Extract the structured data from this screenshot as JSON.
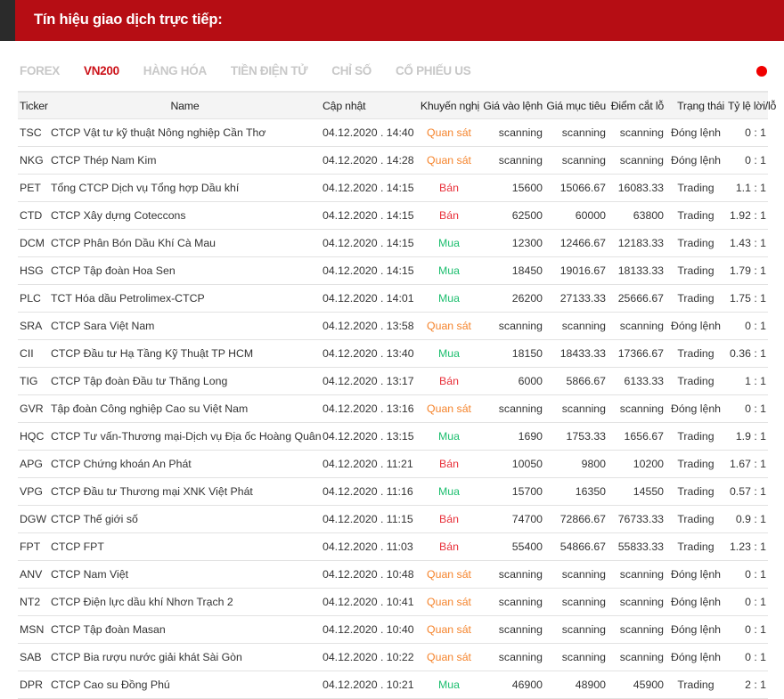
{
  "header": {
    "title": "Tín hiệu giao dịch trực tiếp:"
  },
  "tabs": [
    {
      "label": "FOREX",
      "active": false
    },
    {
      "label": "VN200",
      "active": true
    },
    {
      "label": "HÀNG HÓA",
      "active": false
    },
    {
      "label": "TIỀN ĐIỆN TỬ",
      "active": false
    },
    {
      "label": "CHỈ SỐ",
      "active": false
    },
    {
      "label": "CỔ PHIẾU US",
      "active": false
    }
  ],
  "live_indicator_color": "#f00000",
  "colors": {
    "Quan sát": "#f5842c",
    "Bán": "#e8303a",
    "Mua": "#1cbe6e"
  },
  "table": {
    "columns": [
      "Ticker",
      "Name",
      "Cập nhật",
      "Khuyến nghị",
      "Giá vào lệnh",
      "Giá mục tiêu",
      "Điểm cắt lỗ",
      "Trạng thái",
      "Tỷ lệ lời/lỗ"
    ],
    "rows": [
      [
        "TSC",
        "CTCP Vật tư kỹ thuật Nông nghiệp Cần Thơ",
        "04.12.2020 . 14:40",
        "Quan sát",
        "scanning",
        "scanning",
        "scanning",
        "Đóng lệnh",
        "0 : 1"
      ],
      [
        "NKG",
        "CTCP Thép Nam Kim",
        "04.12.2020 . 14:28",
        "Quan sát",
        "scanning",
        "scanning",
        "scanning",
        "Đóng lệnh",
        "0 : 1"
      ],
      [
        "PET",
        "Tổng CTCP Dịch vụ Tổng hợp Dầu khí",
        "04.12.2020 . 14:15",
        "Bán",
        "15600",
        "15066.67",
        "16083.33",
        "Trading",
        "1.1 : 1"
      ],
      [
        "CTD",
        "CTCP Xây dựng Coteccons",
        "04.12.2020 . 14:15",
        "Bán",
        "62500",
        "60000",
        "63800",
        "Trading",
        "1.92 : 1"
      ],
      [
        "DCM",
        "CTCP Phân Bón Dầu Khí Cà Mau",
        "04.12.2020 . 14:15",
        "Mua",
        "12300",
        "12466.67",
        "12183.33",
        "Trading",
        "1.43 : 1"
      ],
      [
        "HSG",
        "CTCP Tập đoàn Hoa Sen",
        "04.12.2020 . 14:15",
        "Mua",
        "18450",
        "19016.67",
        "18133.33",
        "Trading",
        "1.79 : 1"
      ],
      [
        "PLC",
        "TCT Hóa dầu Petrolimex-CTCP",
        "04.12.2020 . 14:01",
        "Mua",
        "26200",
        "27133.33",
        "25666.67",
        "Trading",
        "1.75 : 1"
      ],
      [
        "SRA",
        "CTCP Sara Việt Nam",
        "04.12.2020 . 13:58",
        "Quan sát",
        "scanning",
        "scanning",
        "scanning",
        "Đóng lệnh",
        "0 : 1"
      ],
      [
        "CII",
        "CTCP Đầu tư Hạ Tầng Kỹ Thuật TP HCM",
        "04.12.2020 . 13:40",
        "Mua",
        "18150",
        "18433.33",
        "17366.67",
        "Trading",
        "0.36 : 1"
      ],
      [
        "TIG",
        "CTCP Tập đoàn Đầu tư Thăng Long",
        "04.12.2020 . 13:17",
        "Bán",
        "6000",
        "5866.67",
        "6133.33",
        "Trading",
        "1 : 1"
      ],
      [
        "GVR",
        "Tập đoàn Công nghiệp Cao su Việt Nam",
        "04.12.2020 . 13:16",
        "Quan sát",
        "scanning",
        "scanning",
        "scanning",
        "Đóng lệnh",
        "0 : 1"
      ],
      [
        "HQC",
        "CTCP Tư vấn-Thương mại-Dịch vụ Địa ốc Hoàng Quân",
        "04.12.2020 . 13:15",
        "Mua",
        "1690",
        "1753.33",
        "1656.67",
        "Trading",
        "1.9 : 1"
      ],
      [
        "APG",
        "CTCP Chứng khoán An Phát",
        "04.12.2020 . 11:21",
        "Bán",
        "10050",
        "9800",
        "10200",
        "Trading",
        "1.67 : 1"
      ],
      [
        "VPG",
        "CTCP Đầu tư Thương mại XNK Việt Phát",
        "04.12.2020 . 11:16",
        "Mua",
        "15700",
        "16350",
        "14550",
        "Trading",
        "0.57 : 1"
      ],
      [
        "DGW",
        "CTCP Thế giới số",
        "04.12.2020 . 11:15",
        "Bán",
        "74700",
        "72866.67",
        "76733.33",
        "Trading",
        "0.9 : 1"
      ],
      [
        "FPT",
        "CTCP FPT",
        "04.12.2020 . 11:03",
        "Bán",
        "55400",
        "54866.67",
        "55833.33",
        "Trading",
        "1.23 : 1"
      ],
      [
        "ANV",
        "CTCP Nam Việt",
        "04.12.2020 . 10:48",
        "Quan sát",
        "scanning",
        "scanning",
        "scanning",
        "Đóng lệnh",
        "0 : 1"
      ],
      [
        "NT2",
        "CTCP Điện lực dầu khí Nhơn Trạch 2",
        "04.12.2020 . 10:41",
        "Quan sát",
        "scanning",
        "scanning",
        "scanning",
        "Đóng lệnh",
        "0 : 1"
      ],
      [
        "MSN",
        "CTCP Tập đoàn Masan",
        "04.12.2020 . 10:40",
        "Quan sát",
        "scanning",
        "scanning",
        "scanning",
        "Đóng lệnh",
        "0 : 1"
      ],
      [
        "SAB",
        "CTCP Bia rượu nước giải khát Sài Gòn",
        "04.12.2020 . 10:22",
        "Quan sát",
        "scanning",
        "scanning",
        "scanning",
        "Đóng lệnh",
        "0 : 1"
      ],
      [
        "DPR",
        "CTCP Cao su Đồng Phú",
        "04.12.2020 . 10:21",
        "Mua",
        "46900",
        "48900",
        "45900",
        "Trading",
        "2 : 1"
      ]
    ]
  }
}
